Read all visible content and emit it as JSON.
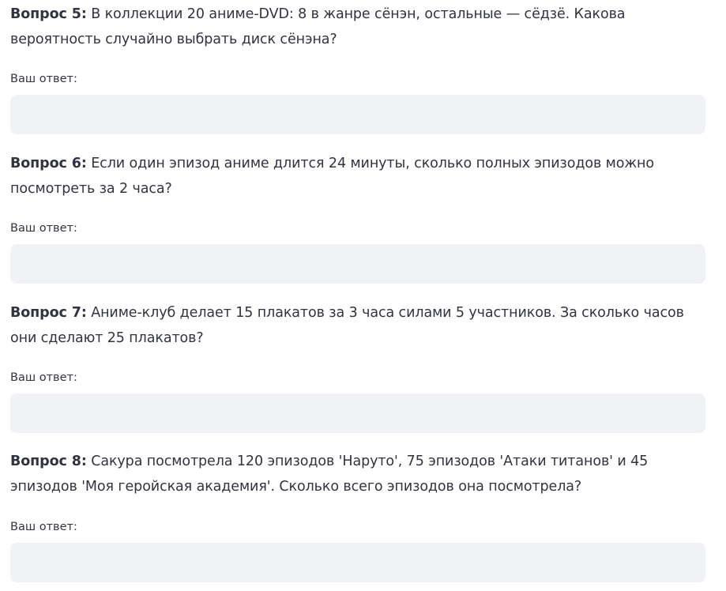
{
  "questions": [
    {
      "number_label": "Вопрос 5:",
      "text": " В коллекции 20 аниме-DVD: 8 в жанре сёнэн, остальные — сёдзё. Какова вероятность случайно выбрать диск сёнэна?",
      "answer_label": "Ваш ответ:",
      "answer_value": ""
    },
    {
      "number_label": "Вопрос 6:",
      "text": " Если один эпизод аниме длится 24 минуты, сколько полных эпизодов можно посмотреть за 2 часа?",
      "answer_label": "Ваш ответ:",
      "answer_value": ""
    },
    {
      "number_label": "Вопрос 7:",
      "text": " Аниме-клуб делает 15 плакатов за 3 часа силами 5 участников. За сколько часов они сделают 25 плакатов?",
      "answer_label": "Ваш ответ:",
      "answer_value": ""
    },
    {
      "number_label": "Вопрос 8:",
      "text": " Сакура посмотрела 120 эпизодов 'Наруто', 75 эпизодов 'Атаки титанов' и 45 эпизодов 'Моя геройская академия'. Сколько всего эпизодов она посмотрела?",
      "answer_label": "Ваш ответ:",
      "answer_value": ""
    }
  ]
}
